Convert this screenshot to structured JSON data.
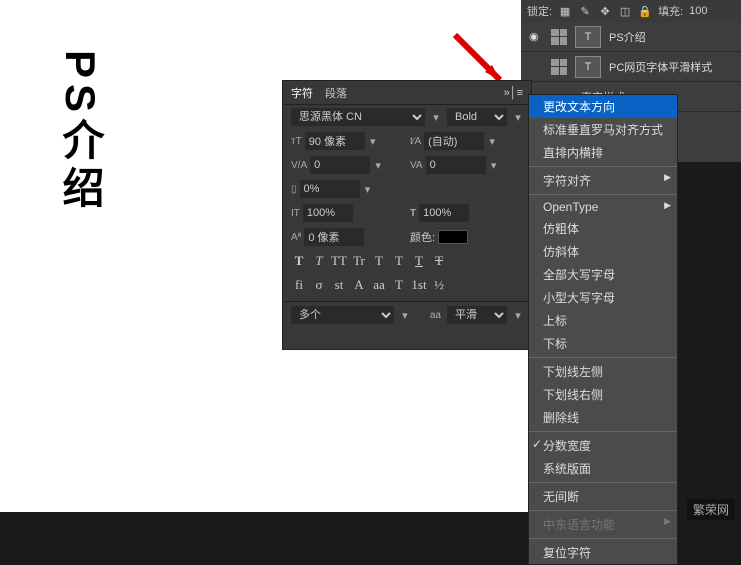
{
  "canvas": {
    "vtext": "PS介绍"
  },
  "topbar": {
    "lock": "锁定:",
    "fill": "填充:",
    "fillval": "100"
  },
  "layers": [
    {
      "thumbT": "T",
      "name": "PS介绍"
    },
    {
      "thumbT": "T",
      "name": "PC网页字体平滑样式"
    }
  ],
  "layerStyle": "真实样式",
  "panel": {
    "tab1": "字符",
    "tab2": "段落",
    "font": "思源黑体 CN",
    "weight": "Bold",
    "sizeLabel": "90 像素",
    "leading": "(自动)",
    "va1": "0",
    "va2": "0",
    "scale": "0%",
    "h100": "100%",
    "w100": "100%",
    "baseline": "0 像素",
    "colorLabel": "颜色:",
    "lang": "多个",
    "aa": "平滑",
    "aaPrefix": "aa"
  },
  "btnRow1": [
    "T",
    "T",
    "TT",
    "Tr",
    "T",
    "T",
    "T",
    "T"
  ],
  "btnRow2": [
    "fi",
    "σ",
    "st",
    "A",
    "aa",
    "T",
    "1st",
    "½"
  ],
  "menu": [
    {
      "t": "更改文本方向",
      "sel": true
    },
    {
      "t": "标准垂直罗马对齐方式"
    },
    {
      "t": "直排内横排"
    },
    {
      "sep": true
    },
    {
      "t": "字符对齐",
      "sub": true
    },
    {
      "sep": true
    },
    {
      "t": "OpenType",
      "sub": true
    },
    {
      "t": "仿粗体"
    },
    {
      "t": "仿斜体"
    },
    {
      "t": "全部大写字母"
    },
    {
      "t": "小型大写字母"
    },
    {
      "t": "上标"
    },
    {
      "t": "下标"
    },
    {
      "sep": true
    },
    {
      "t": "下划线左侧"
    },
    {
      "t": "下划线右侧"
    },
    {
      "t": "删除线"
    },
    {
      "sep": true
    },
    {
      "t": "分数宽度",
      "chk": true
    },
    {
      "t": "系统版面"
    },
    {
      "sep": true
    },
    {
      "t": "无间断"
    },
    {
      "sep": true
    },
    {
      "t": "中东语言功能",
      "sub": true,
      "dis": true
    },
    {
      "sep": true
    },
    {
      "t": "复位字符"
    }
  ],
  "watermark": "繁荣网"
}
